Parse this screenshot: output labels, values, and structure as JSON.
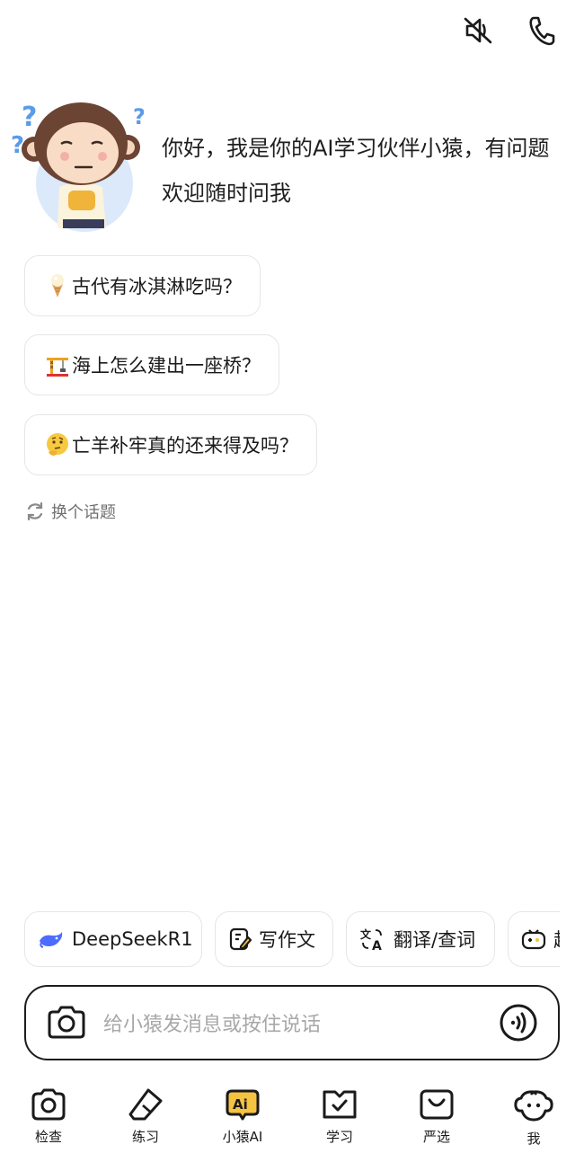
{
  "topbar": {
    "mute_icon": "speaker-mute-icon",
    "phone_icon": "phone-icon"
  },
  "greeting": {
    "text": "你好，我是你的AI学习伙伴小猿，有问题欢迎随时问我"
  },
  "suggestions": [
    {
      "emoji": "ice-cream-icon",
      "text": "古代有冰淇淋吃吗？"
    },
    {
      "emoji": "construction-crane-icon",
      "text": "海上怎么建出一座桥？"
    },
    {
      "emoji": "thinking-face-icon",
      "text": "亡羊补牢真的还来得及吗？"
    }
  ],
  "refresh": {
    "label": "换个话题"
  },
  "tools": [
    {
      "label": "DeepSeekR1",
      "icon": "deepseek-whale-icon"
    },
    {
      "label": "写作文",
      "icon": "write-essay-icon"
    },
    {
      "label": "翻译/查词",
      "icon": "translate-icon"
    },
    {
      "label": "超",
      "icon": "gamepad-icon"
    }
  ],
  "input": {
    "placeholder": "给小猿发消息或按住说话"
  },
  "nav": [
    {
      "label": "检查"
    },
    {
      "label": "练习"
    },
    {
      "label": "小猿AI"
    },
    {
      "label": "学习"
    },
    {
      "label": "严选"
    },
    {
      "label": "我"
    }
  ],
  "colors": {
    "accent_yellow": "#f5c242",
    "border": "#e6e6e6",
    "placeholder": "#a8a8a8"
  }
}
